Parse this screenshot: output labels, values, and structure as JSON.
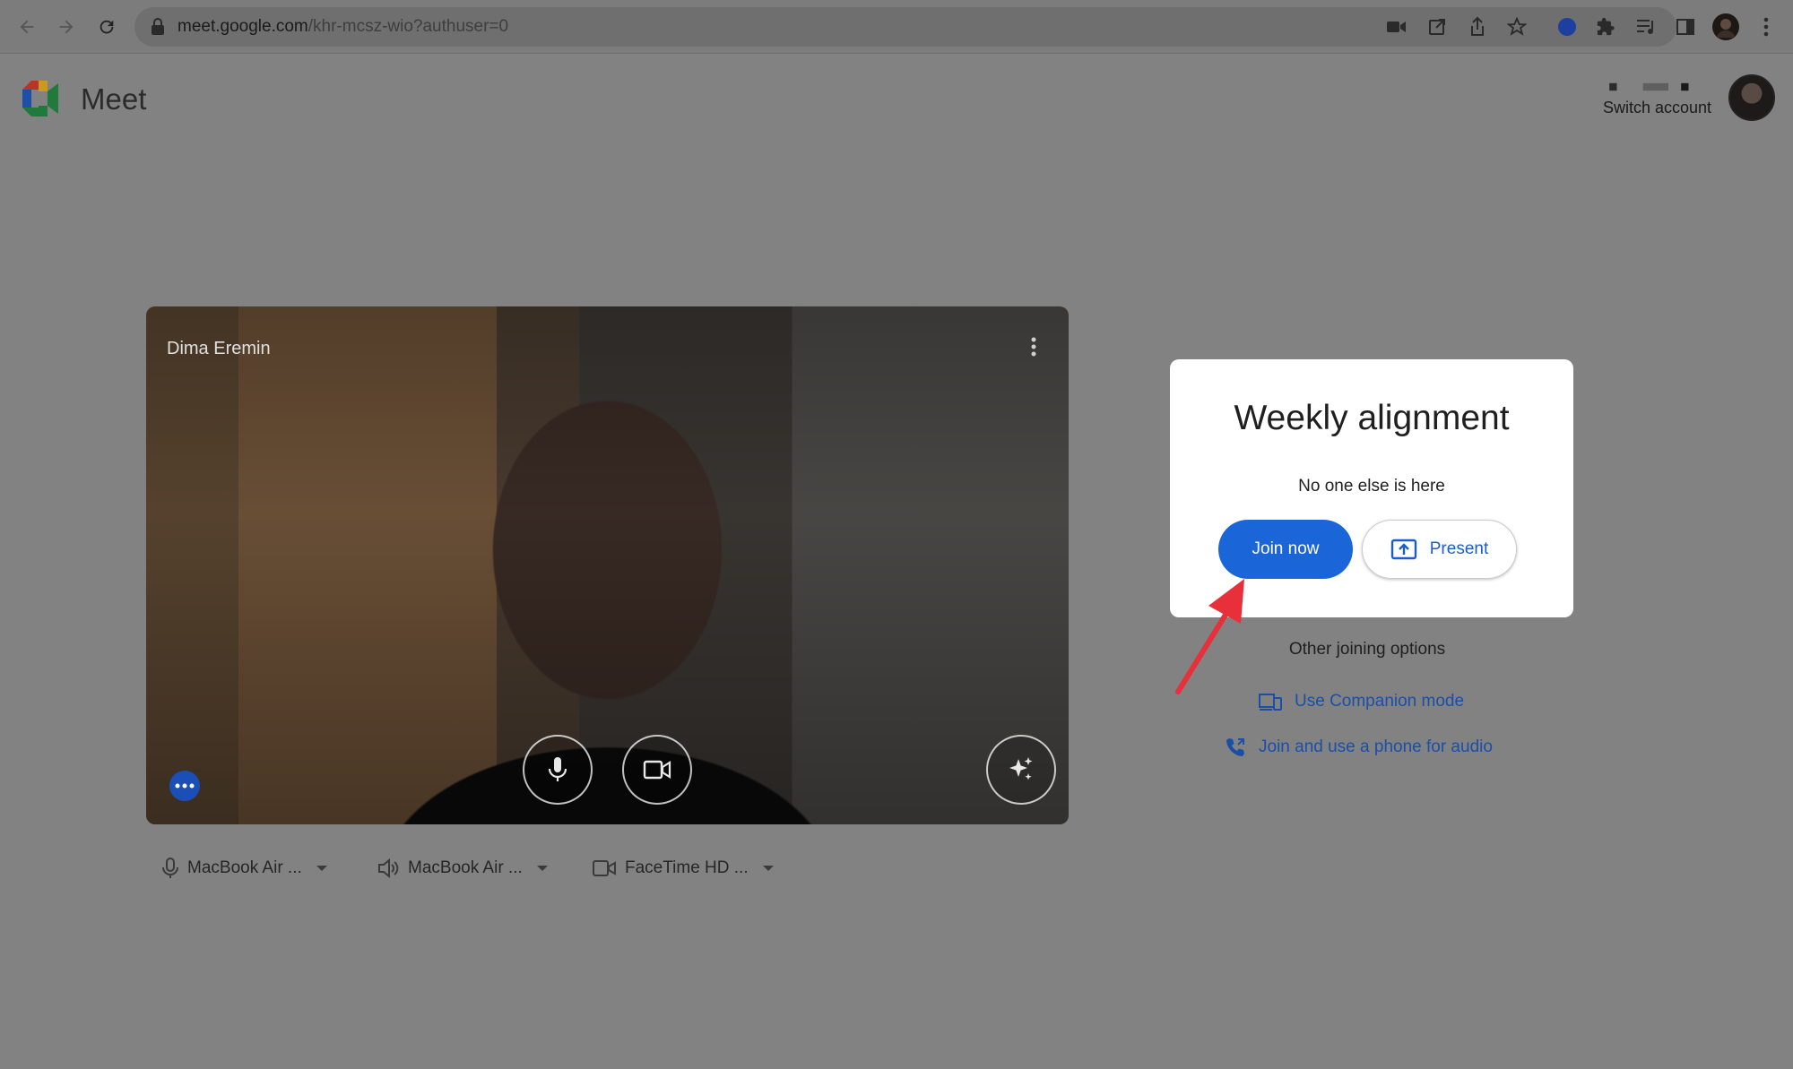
{
  "browser": {
    "url_host": "meet.google.com",
    "url_path": "/khr-mcsz-wio?authuser=0",
    "nav_icons": [
      "back-arrow-icon",
      "forward-arrow-icon",
      "reload-icon"
    ],
    "toolbar_icons": [
      "camera-icon",
      "open-in-window-icon",
      "share-icon",
      "bookmark-star-icon",
      "extension-dot-icon",
      "puzzle-extensions-icon",
      "media-controls-icon",
      "side-panel-icon",
      "profile-avatar-icon",
      "kebab-menu-icon"
    ]
  },
  "header": {
    "app_name": "Meet",
    "switch_account": "Switch account"
  },
  "preview": {
    "participant_name": "Dima Eremin",
    "controls": [
      "microphone-icon",
      "camera-icon",
      "visual-effects-icon"
    ]
  },
  "devices": {
    "microphone": "MacBook Air ...",
    "speaker": "MacBook Air ...",
    "camera": "FaceTime HD ..."
  },
  "join_card": {
    "meeting_title": "Weekly alignment",
    "status": "No one else is here",
    "join_label": "Join now",
    "present_label": "Present"
  },
  "other_options": {
    "label": "Other joining options",
    "companion": "Use Companion mode",
    "phone_audio": "Join and use a phone for audio"
  },
  "colors": {
    "primary_blue": "#1a66d9",
    "link_blue": "#1a4fa8",
    "annotation_red": "#e8303a"
  }
}
